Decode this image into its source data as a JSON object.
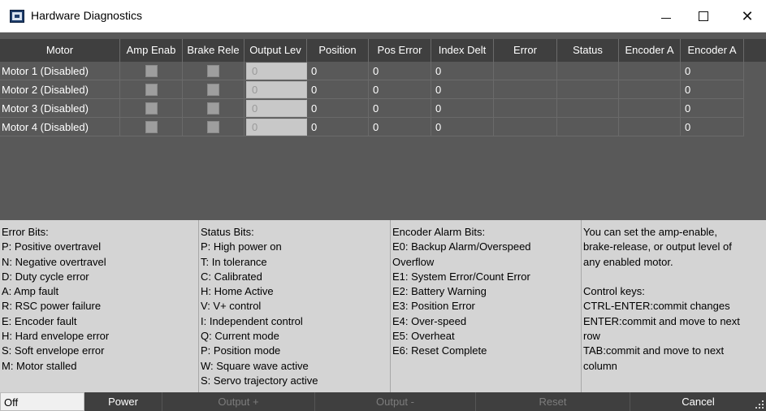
{
  "window": {
    "title": "Hardware Diagnostics",
    "controls": {
      "minimize": "—",
      "maximize": "□",
      "close": "✕"
    }
  },
  "grid": {
    "columns": [
      "Motor",
      "Amp Enab",
      "Brake Rele",
      "Output Lev",
      "Position",
      "Pos Error",
      "Index Delt",
      "Error",
      "Status",
      "Encoder A",
      "Encoder A"
    ],
    "rows": [
      {
        "motor": "Motor 1 (Disabled)",
        "amp_enable": false,
        "brake_release": false,
        "output_level": "0",
        "position": "0",
        "pos_error": "0",
        "index_delta": "0",
        "error": "",
        "status": "",
        "encoder_a1": "",
        "encoder_a2": "0"
      },
      {
        "motor": "Motor 2 (Disabled)",
        "amp_enable": false,
        "brake_release": false,
        "output_level": "0",
        "position": "0",
        "pos_error": "0",
        "index_delta": "0",
        "error": "",
        "status": "",
        "encoder_a1": "",
        "encoder_a2": "0"
      },
      {
        "motor": "Motor 3 (Disabled)",
        "amp_enable": false,
        "brake_release": false,
        "output_level": "0",
        "position": "0",
        "pos_error": "0",
        "index_delta": "0",
        "error": "",
        "status": "",
        "encoder_a1": "",
        "encoder_a2": "0"
      },
      {
        "motor": "Motor 4 (Disabled)",
        "amp_enable": false,
        "brake_release": false,
        "output_level": "0",
        "position": "0",
        "pos_error": "0",
        "index_delta": "0",
        "error": "",
        "status": "",
        "encoder_a1": "",
        "encoder_a2": "0"
      }
    ]
  },
  "info": {
    "error_bits": [
      "Error Bits:",
      "P: Positive overtravel",
      "N: Negative overtravel",
      "D: Duty cycle error",
      "A: Amp fault",
      "R: RSC power failure",
      "E: Encoder fault",
      "H: Hard envelope error",
      "S: Soft envelope error",
      "M: Motor stalled"
    ],
    "status_bits": [
      "Status Bits:",
      "P: High power on",
      "T: In tolerance",
      "C: Calibrated",
      "H: Home Active",
      "V: V+ control",
      "I: Independent control",
      "Q: Current mode",
      "P: Position mode",
      "W: Square wave active",
      "S: Servo trajectory active"
    ],
    "encoder_alarm_bits": [
      "Encoder Alarm Bits:",
      "E0: Backup Alarm/Overspeed",
      "Overflow",
      "E1: System Error/Count Error",
      "E2: Battery Warning",
      "E3: Position Error",
      "E4: Over-speed",
      "E5: Overheat",
      "E6: Reset Complete"
    ],
    "help": [
      "You can set the amp-enable,",
      "brake-release, or output level of",
      "any enabled motor.",
      "",
      "Control keys:",
      "CTRL-ENTER:commit changes",
      "ENTER:commit and move to next",
      "row",
      "TAB:commit and move to next",
      "column"
    ]
  },
  "bottom_bar": {
    "state": "Off",
    "power": "Power",
    "output_plus": "Output +",
    "output_minus": "Output -",
    "reset": "Reset",
    "cancel": "Cancel"
  }
}
